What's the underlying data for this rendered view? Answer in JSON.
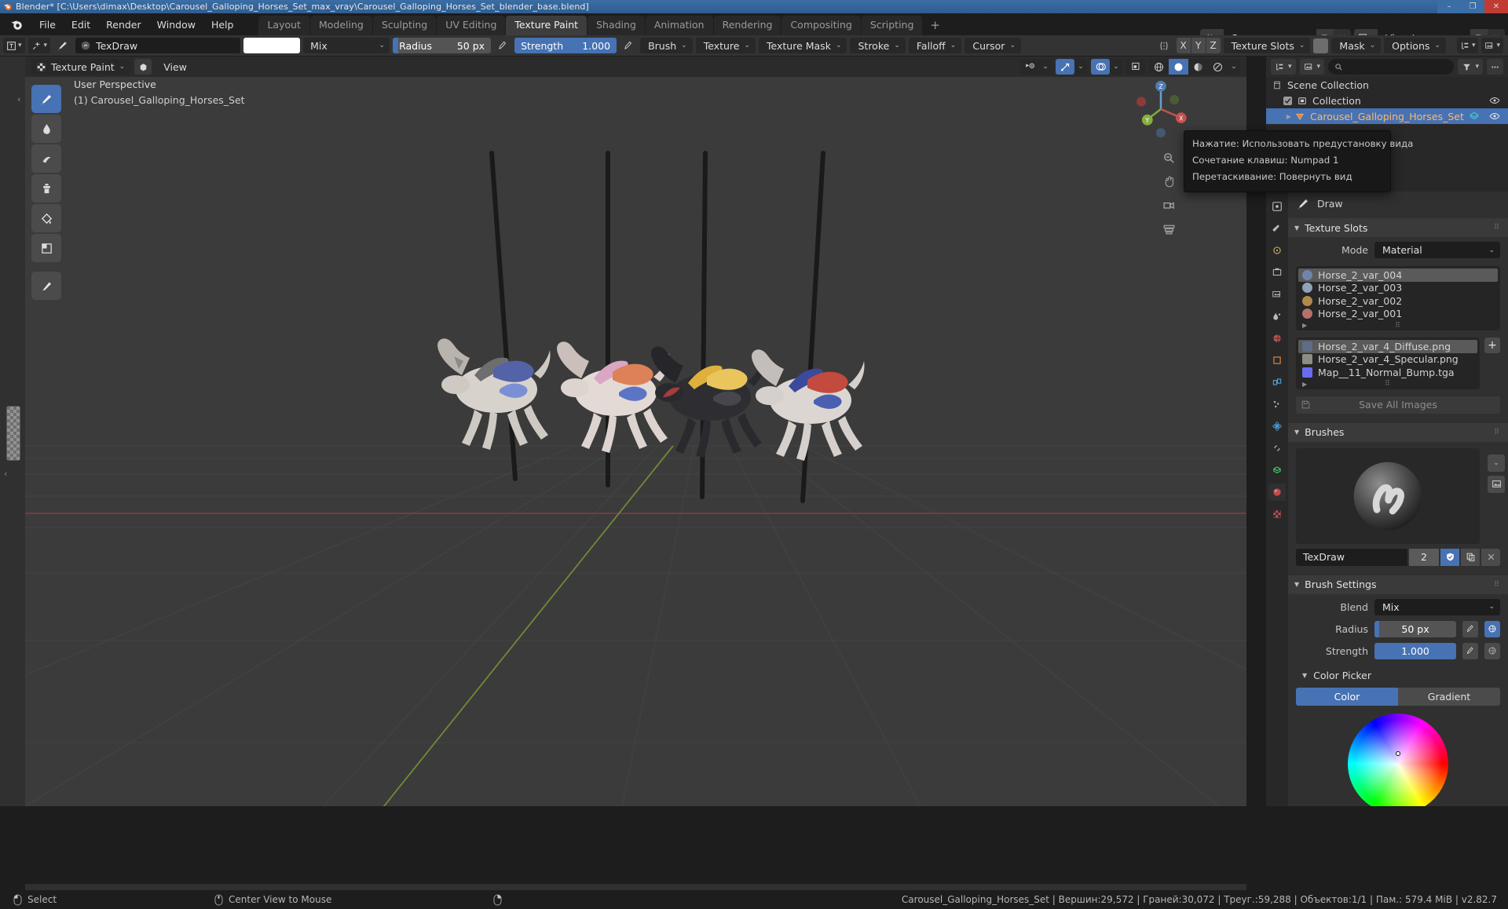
{
  "window": {
    "title": "Blender* [C:\\Users\\dimax\\Desktop\\Carousel_Galloping_Horses_Set_max_vray\\Carousel_Galloping_Horses_Set_blender_base.blend]",
    "minimize": "–",
    "maximize": "❐",
    "close": "✕"
  },
  "menus": [
    "File",
    "Edit",
    "Render",
    "Window",
    "Help"
  ],
  "workspaces": {
    "tabs": [
      "Layout",
      "Modeling",
      "Sculpting",
      "UV Editing",
      "Texture Paint",
      "Shading",
      "Animation",
      "Rendering",
      "Compositing",
      "Scripting"
    ],
    "active": "Texture Paint",
    "add_label": "+"
  },
  "topbar_right": {
    "scene_label": "Scene",
    "view_layer_label": "View Layer",
    "new_icon": "⧉",
    "unlink_icon": "✕"
  },
  "tool_settings": {
    "brush_name": "TexDraw",
    "color_swatch": "#ffffff",
    "blend_mode": "Mix",
    "radius_label": "Radius",
    "radius_value": "50 px",
    "strength_label": "Strength",
    "strength_value": "1.000",
    "menus": [
      "Brush",
      "Texture",
      "Texture Mask",
      "Stroke",
      "Falloff",
      "Cursor"
    ],
    "symmetry_axes": [
      "X",
      "Y",
      "Z"
    ],
    "texture_slots_label": "Texture Slots",
    "mask_label": "Mask",
    "options_label": "Options"
  },
  "viewport": {
    "mode": "Texture Paint",
    "view_menu": "View",
    "overlay_line1": "User Perspective",
    "overlay_line2": "(1) Carousel_Galloping_Horses_Set",
    "gizmo_axes": {
      "x": "X",
      "y": "Y",
      "z": "Z"
    }
  },
  "tooltip": {
    "line1": "Нажатие: Использовать предустановку вида",
    "line2": "Сочетание клавиш: Numpad 1",
    "line3": "Перетаскивание: Повернуть вид"
  },
  "outliner": {
    "rows": [
      {
        "label": "Scene Collection",
        "indent": 0,
        "selected": false,
        "checkbox": false,
        "eye": false
      },
      {
        "label": "Collection",
        "indent": 1,
        "selected": false,
        "checkbox": true,
        "eye": true
      },
      {
        "label": "Carousel_Galloping_Horses_Set",
        "indent": 2,
        "selected": true,
        "checkbox": false,
        "eye": true
      }
    ]
  },
  "properties": {
    "breadcrumb": "Draw",
    "texture_slots": {
      "title": "Texture Slots",
      "mode_label": "Mode",
      "mode_value": "Material",
      "materials": [
        {
          "name": "Horse_2_var_004",
          "selected": true,
          "color": "#6f86a8"
        },
        {
          "name": "Horse_2_var_003",
          "selected": false,
          "color": "#8fa3b6"
        },
        {
          "name": "Horse_2_var_002",
          "selected": false,
          "color": "#b08a4a"
        },
        {
          "name": "Horse_2_var_001",
          "selected": false,
          "color": "#b5726a"
        }
      ],
      "images": [
        {
          "name": "Horse_2_var_4_Diffuse.png",
          "selected": true,
          "color": "#5d6d86"
        },
        {
          "name": "Horse_2_var_4_Specular.png",
          "selected": false,
          "color": "#8d8d85"
        },
        {
          "name": "Map__11_Normal_Bump.tga",
          "selected": false,
          "color": "#6b6bf0"
        }
      ],
      "add_label": "+",
      "save_all_label": "Save All Images"
    },
    "brushes": {
      "title": "Brushes",
      "brush_name": "TexDraw",
      "users_count": "2",
      "fake_user_on": true
    },
    "brush_settings": {
      "title": "Brush Settings",
      "blend_label": "Blend",
      "blend_value": "Mix",
      "radius_label": "Radius",
      "radius_value": "50 px",
      "radius_fill_pct": 6,
      "strength_label": "Strength",
      "strength_value": "1.000",
      "strength_fill_pct": 100
    },
    "color_picker": {
      "title": "Color Picker",
      "tab_color": "Color",
      "tab_gradient": "Gradient",
      "active_tab": "Color"
    }
  },
  "statusbar": {
    "left_action": "Select",
    "middle_action": "Center View to Mouse",
    "stats": "Carousel_Galloping_Horses_Set | Вершин:29,572 | Граней:30,072 | Треуг.:59,288 | Объектов:1/1 | Пам.: 579.4 MiB | v2.82.7"
  },
  "colors": {
    "accent": "#4772b3",
    "panel": "#303030",
    "header": "#2b2b2b",
    "viewport_bg": "#3b3b3b",
    "selected_text": "#ffb86b"
  }
}
